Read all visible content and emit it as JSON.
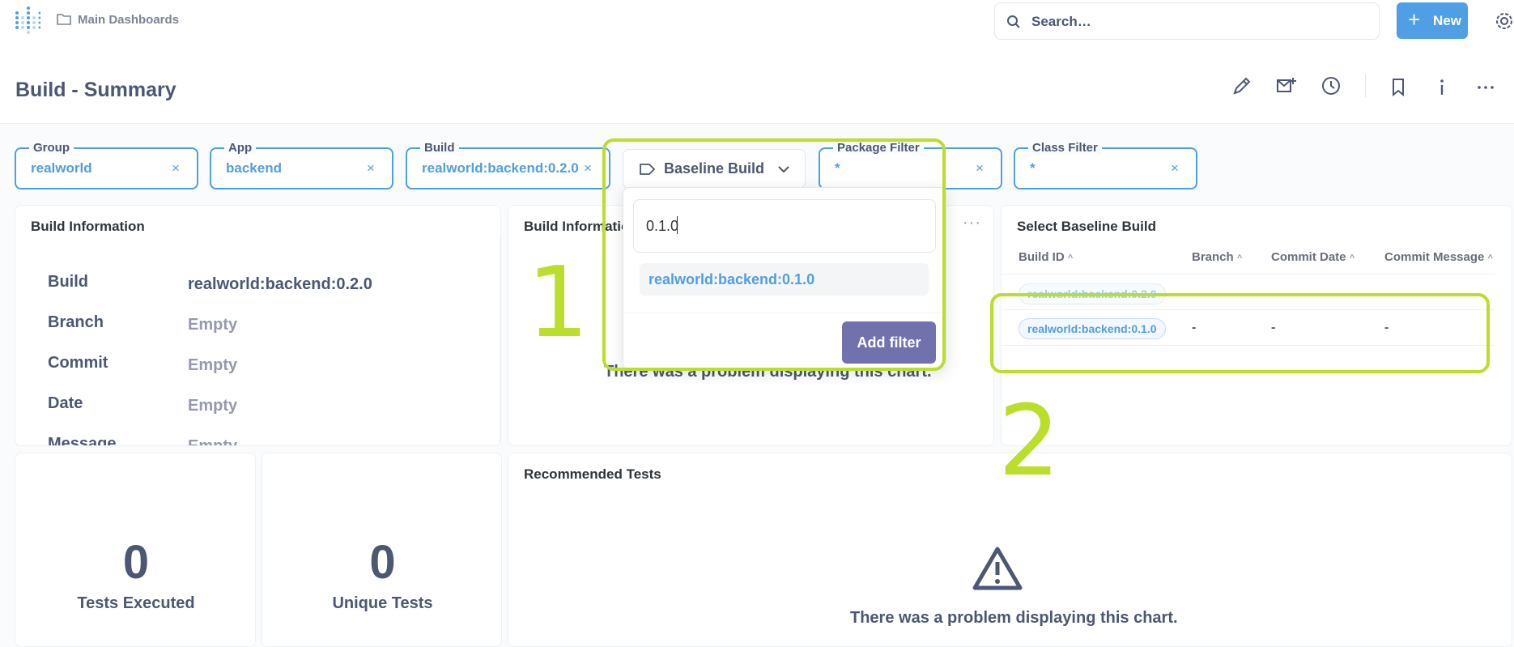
{
  "nav": {
    "breadcrumb": "Main Dashboards",
    "search_placeholder": "Search…",
    "new_label": "New"
  },
  "dashboard": {
    "title": "Build - Summary"
  },
  "filters": {
    "group": {
      "label": "Group",
      "value": "realworld"
    },
    "app": {
      "label": "App",
      "value": "backend"
    },
    "build": {
      "label": "Build",
      "value": "realworld:backend:0.2.0"
    },
    "baseline": {
      "label": "Baseline Build"
    },
    "package": {
      "label": "Package Filter",
      "value": "*"
    },
    "class": {
      "label": "Class Filter",
      "value": "*"
    },
    "clear_symbol": "×"
  },
  "popover": {
    "search_value": "0.1.0",
    "option": "realworld:backend:0.1.0",
    "add_filter_label": "Add filter"
  },
  "build_info_card": {
    "title": "Build Information",
    "rows": [
      {
        "key": "Build",
        "value": "realworld:backend:0.2.0"
      },
      {
        "key": "Branch",
        "value": "Empty"
      },
      {
        "key": "Commit",
        "value": "Empty"
      },
      {
        "key": "Date",
        "value": "Empty"
      },
      {
        "key": "Message",
        "value": "Empty"
      }
    ]
  },
  "build_info_card2": {
    "title": "Build Informatio",
    "problem": "There was a problem displaying this chart.",
    "more": "···"
  },
  "baseline_card": {
    "title": "Select Baseline Build",
    "columns": [
      "Build ID",
      "Branch",
      "Commit Date",
      "Commit Message"
    ],
    "sort_symbol": "^",
    "rows": [
      {
        "build_id": "realworld:backend:0.2.0",
        "branch": "",
        "date": "",
        "message": ""
      },
      {
        "build_id": "realworld:backend:0.1.0",
        "branch": "-",
        "date": "-",
        "message": "-"
      }
    ]
  },
  "tests_executed": {
    "value": "0",
    "label": "Tests Executed"
  },
  "unique_tests": {
    "value": "0",
    "label": "Unique Tests"
  },
  "recommended": {
    "title": "Recommended Tests",
    "problem": "There was a problem displaying this chart."
  },
  "annotations": {
    "one": "1",
    "two": "2",
    "color": "#bbdd2b"
  },
  "colors": {
    "brand": "#509ee3",
    "text": "#4c5773",
    "muted": "#949aab",
    "add_filter": "#7172ad"
  }
}
